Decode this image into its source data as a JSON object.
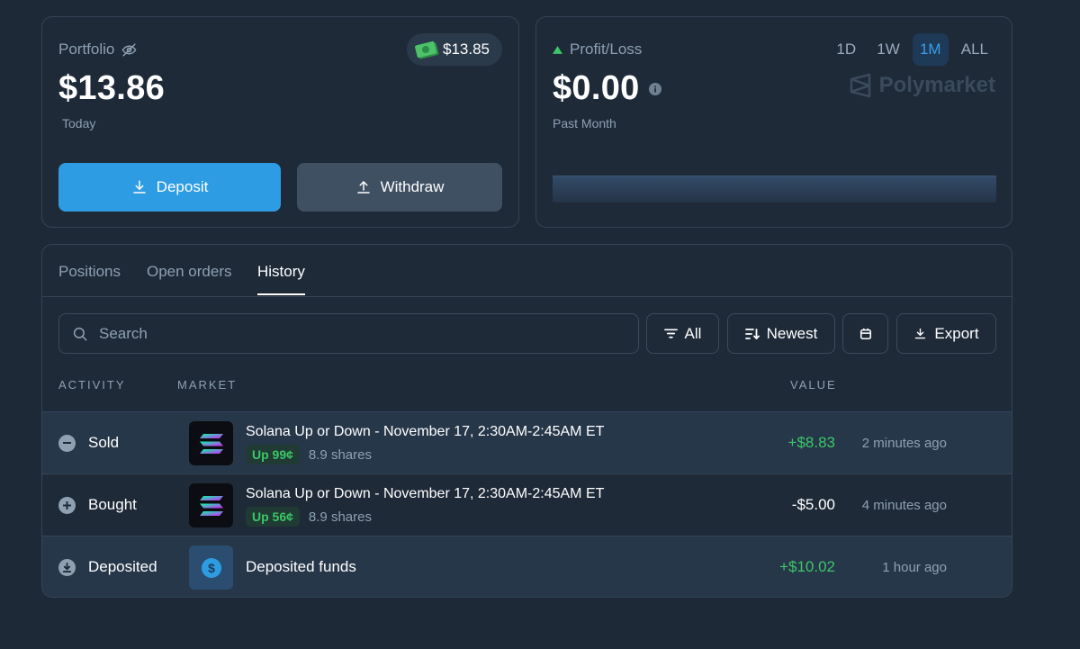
{
  "portfolio": {
    "label": "Portfolio",
    "value": "$13.86",
    "period": "Today",
    "cash_balance": "$13.85",
    "deposit_label": "Deposit",
    "withdraw_label": "Withdraw"
  },
  "pnl": {
    "label": "Profit/Loss",
    "value": "$0.00",
    "period": "Past Month",
    "brand": "Polymarket",
    "ranges": [
      "1D",
      "1W",
      "1M",
      "ALL"
    ],
    "active_range": "1M"
  },
  "history": {
    "tabs": [
      "Positions",
      "Open orders",
      "History"
    ],
    "active_tab": "History",
    "search_placeholder": "Search",
    "filter_label": "All",
    "sort_label": "Newest",
    "export_label": "Export",
    "columns": {
      "activity": "ACTIVITY",
      "market": "MARKET",
      "value": "VALUE"
    },
    "rows": [
      {
        "activity": "Sold",
        "market": "Solana Up or Down - November 17, 2:30AM-2:45AM ET",
        "outcome": "Up 99¢",
        "shares": "8.9 shares",
        "value": "+$8.83",
        "time": "2 minutes ago"
      },
      {
        "activity": "Bought",
        "market": "Solana Up or Down - November 17, 2:30AM-2:45AM ET",
        "outcome": "Up 56¢",
        "shares": "8.9 shares",
        "value": "-$5.00",
        "time": "4 minutes ago"
      },
      {
        "activity": "Deposited",
        "market": "Deposited funds",
        "value": "+$10.02",
        "time": "1 hour ago"
      }
    ]
  },
  "colors": {
    "accent": "#2e9ce3",
    "positive": "#3cc668",
    "background": "#1d2936"
  }
}
